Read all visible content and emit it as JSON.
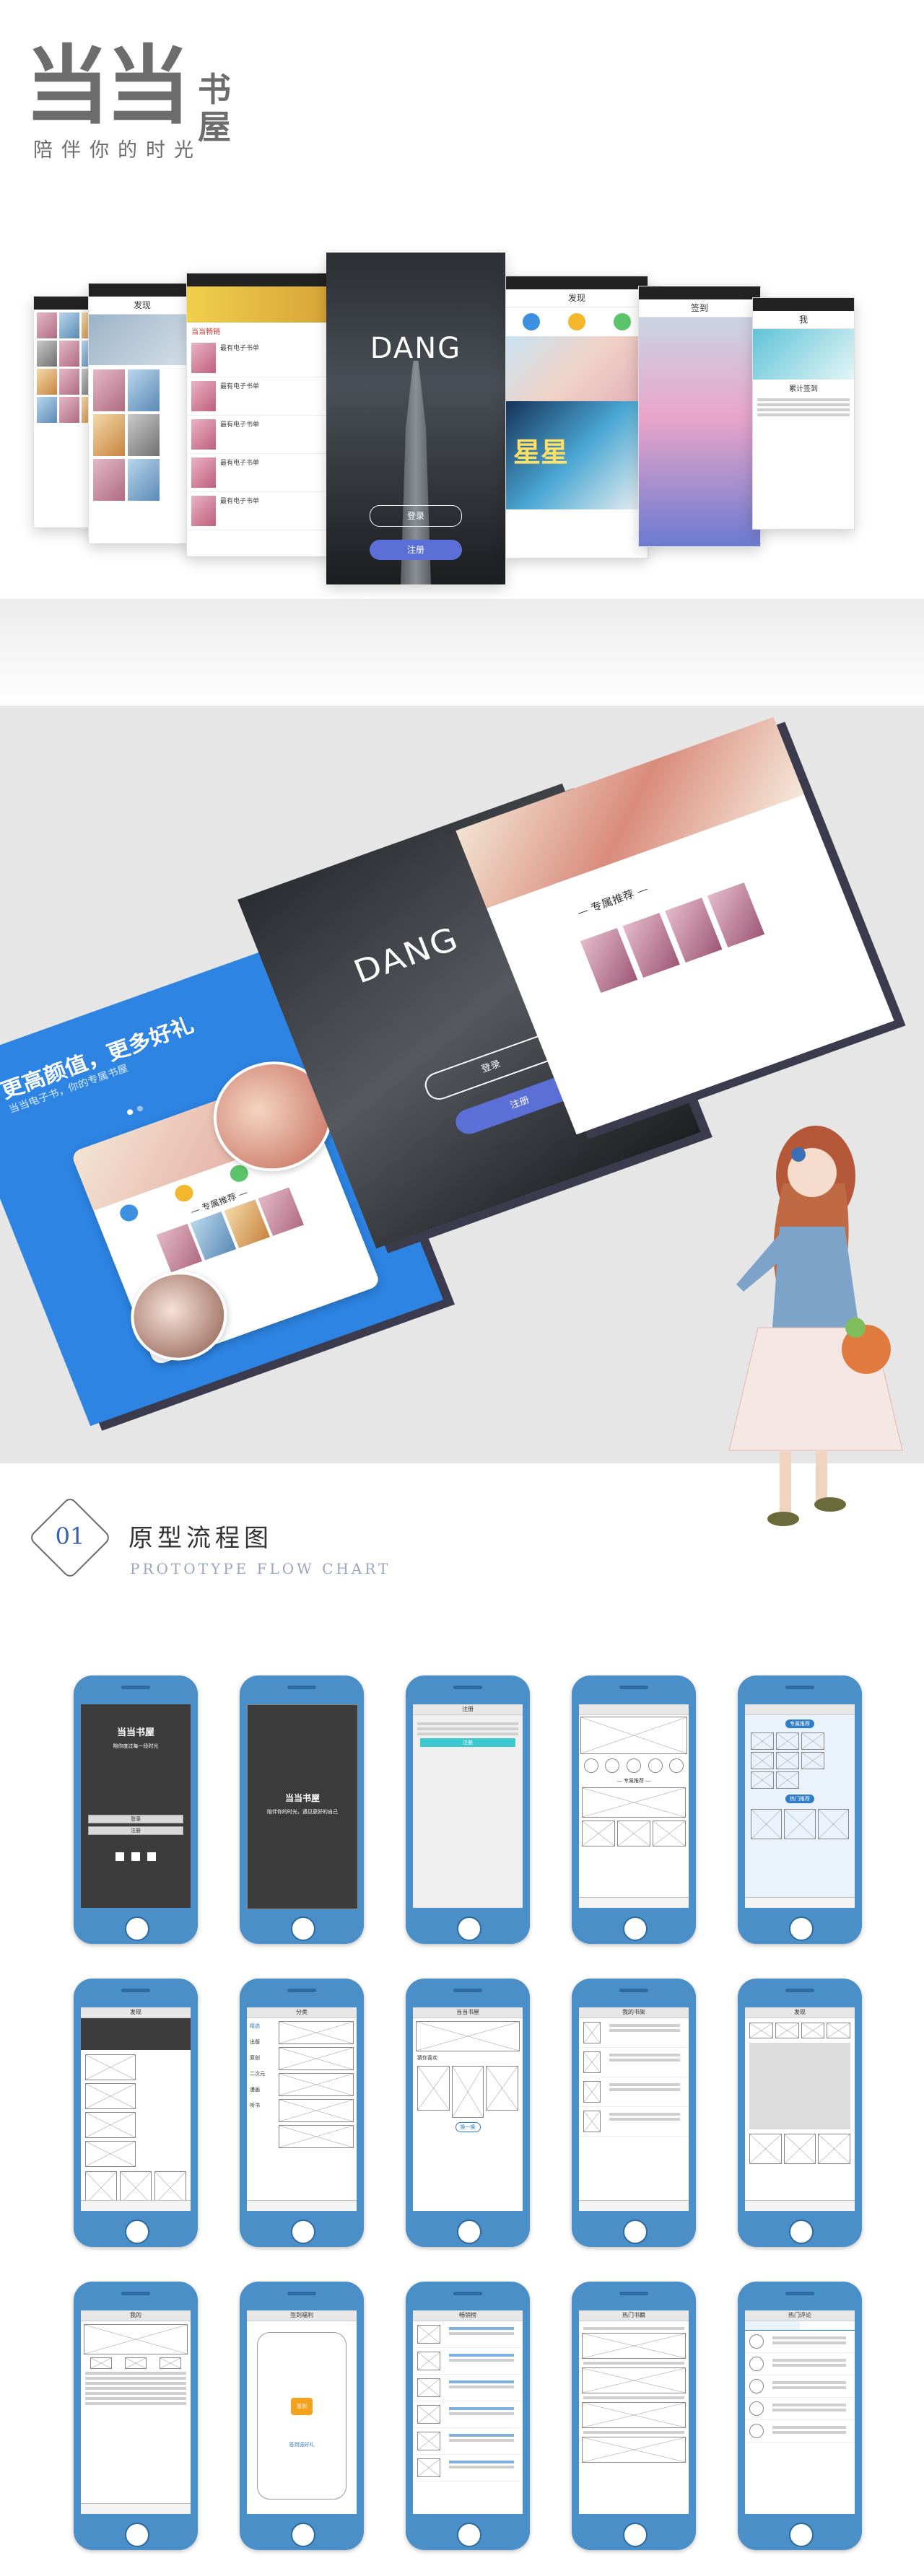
{
  "logo": {
    "main": "当当",
    "side_top": "书",
    "side_bottom": "屋",
    "slogan": "陪伴你的时光"
  },
  "screens": {
    "find_title": "发现",
    "sign_title": "签到",
    "mine_title": "我",
    "sign_days": "累计签到",
    "login_brand": "DANG",
    "login_button": "登录",
    "register_button": "注册",
    "book_cover_text": "星星",
    "list_heading": "当当畅销",
    "list_item": "最有电子书单"
  },
  "showcase": {
    "slogan": "更高颜值，更多好礼",
    "sub": "当当电子书，你的专属书屋",
    "brand": "DANG",
    "login": "登录",
    "register": "注册",
    "recommend": "— 专属推荐 —"
  },
  "section": {
    "number": "01",
    "title": "原型流程图",
    "subtitle": "PROTOTYPE FLOW CHART"
  },
  "wire": {
    "splash_title": "当当书屋",
    "splash_sub": "陪你度过每一段时光",
    "login_btn": "登录",
    "reg_btn": "注册",
    "splash2_title": "当当书屋",
    "splash2_sub": "陪伴你的时光，遇见更好的自己",
    "register_title": "注册",
    "register_btn": "注册",
    "home_recommend": "— 专属推荐 —",
    "pill_a": "专属推荐",
    "pill_b": "热门推荐",
    "find_title": "发现",
    "cat_title": "分类",
    "cat_items": [
      "精选",
      "出版",
      "原创",
      "二次元",
      "漫画",
      "听书"
    ],
    "store_title": "当当书屋",
    "store_tip": "猜你喜欢",
    "store_btn": "换一换",
    "my_shelf": "我的书架",
    "find2": "发现",
    "my": "我的",
    "sign_title": "签到福利",
    "sign_btn": "签到",
    "sign_tip": "签到送好礼",
    "charts": "畅销榜",
    "hot": "热门书籍",
    "fans": "热门评论"
  }
}
